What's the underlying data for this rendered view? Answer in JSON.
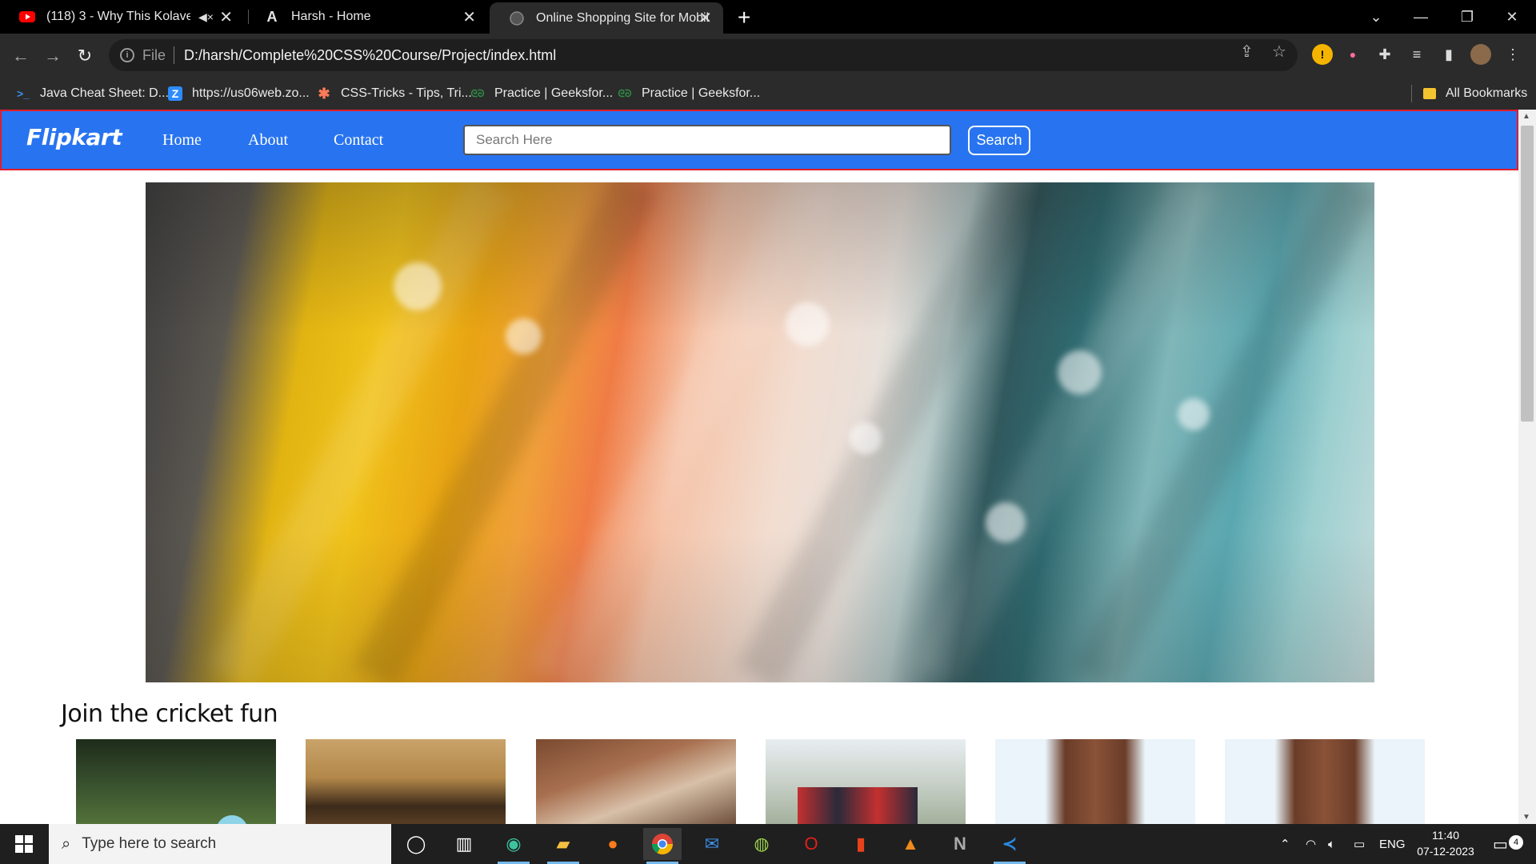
{
  "browser": {
    "tabs": [
      {
        "title": "(118) 3 - Why This Kolaveri D",
        "favicon": "youtube-icon"
      },
      {
        "title": "Harsh - Home",
        "favicon": "a-logo-icon"
      },
      {
        "title": "Online Shopping Site for Mobile",
        "favicon": "globe-icon"
      }
    ],
    "url_scheme": "File",
    "url": "D:/harsh/Complete%20CSS%20Course/Project/index.html",
    "bookmarks": [
      {
        "label": "Java Cheat Sheet: D...",
        "icon": "terminal-icon"
      },
      {
        "label": "https://us06web.zo...",
        "icon": "zoom-icon"
      },
      {
        "label": "CSS-Tricks - Tips, Tri...",
        "icon": "css-tricks-icon"
      },
      {
        "label": "Practice | Geeksfor...",
        "icon": "gfg-icon"
      },
      {
        "label": "Practice | Geeksfor...",
        "icon": "gfg-icon"
      }
    ],
    "all_bookmarks": "All Bookmarks"
  },
  "site": {
    "logo": "Flipkart",
    "nav": [
      "Home",
      "About",
      "Contact"
    ],
    "search_placeholder": "Search Here",
    "search_button": "Search",
    "section_title": "Join the cricket fun",
    "colors": {
      "navbar": "#2874f0",
      "border": "#e11d2a"
    }
  },
  "taskbar": {
    "search_placeholder": "Type here to search",
    "language": "ENG",
    "time": "11:40",
    "date": "07-12-2023",
    "notifications": "4"
  }
}
